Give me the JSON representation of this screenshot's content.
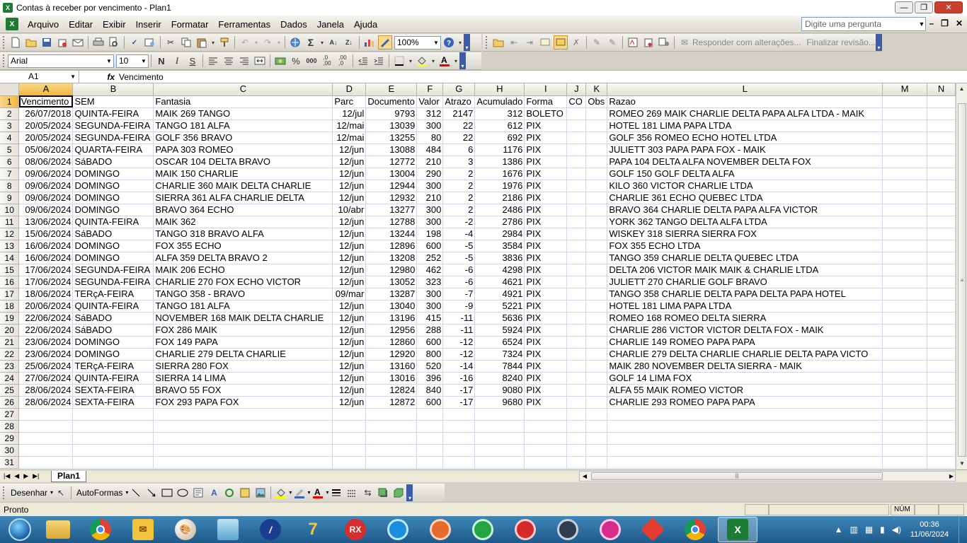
{
  "window": {
    "title": "Contas à receber por vencimento - Plan1",
    "min_icon": "minimize-icon",
    "max_icon": "maximize-icon",
    "close_icon": "close-icon",
    "min_glyph": "—",
    "max_glyph": "❐",
    "close_glyph": "✕"
  },
  "menu": {
    "items": [
      "Arquivo",
      "Editar",
      "Exibir",
      "Inserir",
      "Formatar",
      "Ferramentas",
      "Dados",
      "Janela",
      "Ajuda"
    ],
    "underline": [
      "A",
      "E",
      "x",
      "I",
      "F",
      "r",
      "D",
      "J",
      "u"
    ],
    "ask_placeholder": "Digite uma pergunta",
    "mdi_min": "–",
    "mdi_restore": "❐",
    "mdi_close": "✕"
  },
  "toolbar": {
    "zoom": "100%",
    "reply_label": "Responder com alterações...",
    "finish_label": "Finalizar revisão..."
  },
  "format_toolbar": {
    "font": "Arial",
    "size": "10",
    "bold": "N",
    "italic": "I",
    "underline": "S",
    "percent": "%",
    "thousands": "000"
  },
  "formula_bar": {
    "name_box": "A1",
    "fx": "fx",
    "value": "Vencimento"
  },
  "sheet": {
    "columns": [
      "A",
      "B",
      "C",
      "D",
      "E",
      "F",
      "G",
      "H",
      "I",
      "J",
      "K",
      "L",
      "M",
      "N"
    ],
    "header": [
      "Vencimento",
      "SEM",
      "Fantasia",
      "Parc",
      "Documento",
      "Valor",
      "Atrazo",
      "Acumulado",
      "Forma",
      "CO",
      "Obs",
      "Razao"
    ],
    "rows": [
      [
        "26/07/2018",
        "QUINTA-FEIRA",
        "MAIK 269 TANGO",
        "12/jul",
        "9793",
        "312",
        "2147",
        "312",
        "BOLETO",
        "",
        "",
        "ROMEO 269 MAIK CHARLIE DELTA PAPA ALFA LTDA - MAIK"
      ],
      [
        "20/05/2024",
        "SEGUNDA-FEIRA",
        "TANGO 181 ALFA",
        "12/mai",
        "13039",
        "300",
        "22",
        "612",
        "PIX",
        "",
        "",
        "HOTEL 181 LIMA PAPA LTDA"
      ],
      [
        "20/05/2024",
        "SEGUNDA-FEIRA",
        "GOLF 356 BRAVO",
        "12/mai",
        "13255",
        "80",
        "22",
        "692",
        "PIX",
        "",
        "",
        "GOLF 356 ROMEO ECHO HOTEL LTDA"
      ],
      [
        "05/06/2024",
        "QUARTA-FEIRA",
        "PAPA 303 ROMEO",
        "12/jun",
        "13088",
        "484",
        "6",
        "1176",
        "PIX",
        "",
        "",
        "JULIETT 303 PAPA PAPA FOX - MAIK"
      ],
      [
        "08/06/2024",
        "SáBADO",
        "OSCAR 104 DELTA BRAVO",
        "12/jun",
        "12772",
        "210",
        "3",
        "1386",
        "PIX",
        "",
        "",
        "PAPA 104 DELTA ALFA NOVEMBER DELTA FOX"
      ],
      [
        "09/06/2024",
        "DOMINGO",
        "MAIK 150 CHARLIE",
        "12/jun",
        "13004",
        "290",
        "2",
        "1676",
        "PIX",
        "",
        "",
        "GOLF 150 GOLF DELTA ALFA"
      ],
      [
        "09/06/2024",
        "DOMINGO",
        "CHARLIE 360 MAIK DELTA CHARLIE",
        "12/jun",
        "12944",
        "300",
        "2",
        "1976",
        "PIX",
        "",
        "",
        "KILO 360 VICTOR CHARLIE LTDA"
      ],
      [
        "09/06/2024",
        "DOMINGO",
        "SIERRA 361 ALFA CHARLIE DELTA",
        "12/jun",
        "12932",
        "210",
        "2",
        "2186",
        "PIX",
        "",
        "",
        "CHARLIE 361 ECHO QUEBEC LTDA"
      ],
      [
        "09/06/2024",
        "DOMINGO",
        "BRAVO 364 ECHO",
        "10/abr",
        "13277",
        "300",
        "2",
        "2486",
        "PIX",
        "",
        "",
        "BRAVO 364 CHARLIE DELTA PAPA ALFA VICTOR"
      ],
      [
        "13/06/2024",
        "QUINTA-FEIRA",
        "MAIK 362",
        "12/jun",
        "12788",
        "300",
        "-2",
        "2786",
        "PIX",
        "",
        "",
        "YORK 362 TANGO DELTA ALFA LTDA"
      ],
      [
        "15/06/2024",
        "SáBADO",
        "TANGO 318 BRAVO ALFA",
        "12/jun",
        "13244",
        "198",
        "-4",
        "2984",
        "PIX",
        "",
        "",
        "WISKEY 318 SIERRA SIERRA FOX"
      ],
      [
        "16/06/2024",
        "DOMINGO",
        "FOX 355 ECHO",
        "12/jun",
        "12896",
        "600",
        "-5",
        "3584",
        "PIX",
        "",
        "",
        "FOX 355 ECHO LTDA"
      ],
      [
        "16/06/2024",
        "DOMINGO",
        "ALFA 359 DELTA BRAVO 2",
        "12/jun",
        "13208",
        "252",
        "-5",
        "3836",
        "PIX",
        "",
        "",
        "TANGO 359 CHARLIE DELTA QUEBEC LTDA"
      ],
      [
        "17/06/2024",
        "SEGUNDA-FEIRA",
        "MAIK 206 ECHO",
        "12/jun",
        "12980",
        "462",
        "-6",
        "4298",
        "PIX",
        "",
        "",
        "DELTA 206 VICTOR MAIK MAIK & CHARLIE LTDA"
      ],
      [
        "17/06/2024",
        "SEGUNDA-FEIRA",
        "CHARLIE 270 FOX ECHO VICTOR",
        "12/jun",
        "13052",
        "323",
        "-6",
        "4621",
        "PIX",
        "",
        "",
        "JULIETT 270 CHARLIE GOLF BRAVO"
      ],
      [
        "18/06/2024",
        "TERçA-FEIRA",
        "TANGO 358 - BRAVO",
        "09/mar",
        "13287",
        "300",
        "-7",
        "4921",
        "PIX",
        "",
        "",
        "TANGO 358 CHARLIE DELTA PAPA DELTA PAPA HOTEL"
      ],
      [
        "20/06/2024",
        "QUINTA-FEIRA",
        "TANGO 181 ALFA",
        "12/jun",
        "13040",
        "300",
        "-9",
        "5221",
        "PIX",
        "",
        "",
        "HOTEL 181 LIMA PAPA LTDA"
      ],
      [
        "22/06/2024",
        "SáBADO",
        "NOVEMBER 168 MAIK DELTA CHARLIE",
        "12/jun",
        "13196",
        "415",
        "-11",
        "5636",
        "PIX",
        "",
        "",
        "ROMEO 168 ROMEO DELTA SIERRA"
      ],
      [
        "22/06/2024",
        "SáBADO",
        "FOX 286 MAIK",
        "12/jun",
        "12956",
        "288",
        "-11",
        "5924",
        "PIX",
        "",
        "",
        "CHARLIE 286 VICTOR VICTOR DELTA FOX - MAIK"
      ],
      [
        "23/06/2024",
        "DOMINGO",
        "FOX 149 PAPA",
        "12/jun",
        "12860",
        "600",
        "-12",
        "6524",
        "PIX",
        "",
        "",
        "CHARLIE 149 ROMEO PAPA PAPA"
      ],
      [
        "23/06/2024",
        "DOMINGO",
        "CHARLIE 279 DELTA CHARLIE",
        "12/jun",
        "12920",
        "800",
        "-12",
        "7324",
        "PIX",
        "",
        "",
        "CHARLIE 279 DELTA CHARLIE CHARLIE DELTA PAPA VICTO"
      ],
      [
        "25/06/2024",
        "TERçA-FEIRA",
        "SIERRA 280 FOX",
        "12/jun",
        "13160",
        "520",
        "-14",
        "7844",
        "PIX",
        "",
        "",
        "MAIK 280 NOVEMBER DELTA SIERRA - MAIK"
      ],
      [
        "27/06/2024",
        "QUINTA-FEIRA",
        "SIERRA 14 LIMA",
        "12/jun",
        "13016",
        "396",
        "-16",
        "8240",
        "PIX",
        "",
        "",
        "GOLF 14 LIMA FOX"
      ],
      [
        "28/06/2024",
        "SEXTA-FEIRA",
        "BRAVO 55 FOX",
        "12/jun",
        "12824",
        "840",
        "-17",
        "9080",
        "PIX",
        "",
        "",
        "ALFA 55 MAIK ROMEO VICTOR"
      ],
      [
        "28/06/2024",
        "SEXTA-FEIRA",
        "FOX 293 PAPA FOX",
        "12/jun",
        "12872",
        "600",
        "-17",
        "9680",
        "PIX",
        "",
        "",
        "CHARLIE 293 ROMEO PAPA PAPA"
      ]
    ],
    "empty_rows": [
      "27",
      "28",
      "29",
      "30",
      "31"
    ],
    "tab_name": "Plan1"
  },
  "drawing_toolbar": {
    "draw_label": "Desenhar",
    "autoshapes_label": "AutoFormas"
  },
  "status": {
    "left": "Pronto",
    "num": "NÚM"
  },
  "taskbar": {
    "time": "00:36",
    "date": "11/06/2024",
    "apps": [
      "file-explorer-icon",
      "chrome-icon",
      "outlook-icon",
      "paint-icon",
      "notepad-icon",
      "anydesk-icon",
      "seven-app-icon",
      "rx-app-icon",
      "remote-blue-icon",
      "remote-orange-icon",
      "remote-green-icon",
      "remote-red-icon",
      "remote-dark-icon",
      "remote-pink-icon",
      "anydesk-red-icon",
      "chrome-profile-icon",
      "excel-icon"
    ],
    "rx_label": "RX",
    "seven_label": "7"
  },
  "colors": {
    "excel_green": "#1e7b34",
    "selection_header": "#f0b73f",
    "taskbar": "#2a6a9c",
    "toolbar_end": "#3b5bab"
  }
}
